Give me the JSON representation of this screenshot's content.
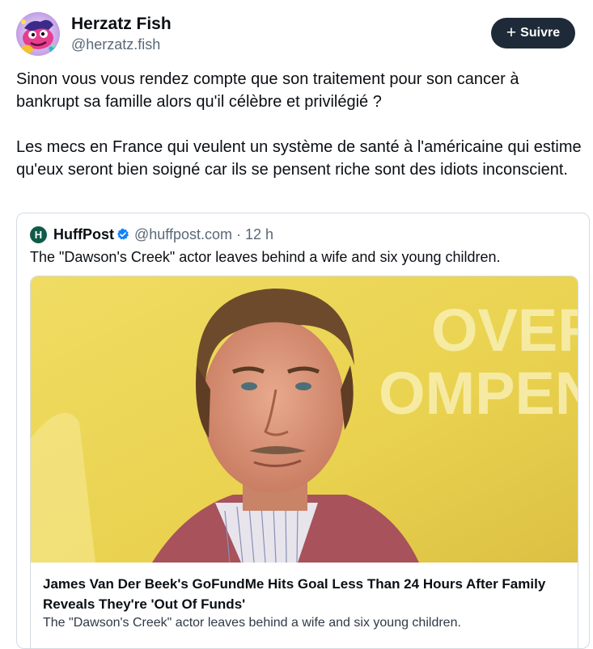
{
  "author": {
    "display_name": "Herzatz Fish",
    "handle": "@herzatz.fish",
    "avatar_icon": "colorful-cartoon-avatar"
  },
  "follow_button": {
    "icon": "plus-icon",
    "label": "Suivre",
    "bg_color": "#1e2a38"
  },
  "post": {
    "paragraph_1": "Sinon vous vous rendez compte que son traitement pour son cancer à bankrupt sa famille alors qu'il célèbre et privilégié ?",
    "paragraph_2": "Les mecs en France qui veulent un système de santé à l'américaine qui estime qu'eux seront bien soigné car ils se pensent riche sont des idiots inconscient."
  },
  "quoted_post": {
    "logo_icon": "huffpost-logo",
    "logo_letter": "H",
    "name": "HuffPost",
    "verified_icon": "verified-badge-icon",
    "handle": "@huffpost.com",
    "separator": "·",
    "time": "12 h",
    "text": "The \"Dawson's Creek\" actor leaves behind a wife and six young children.",
    "link_card": {
      "image": "photo-of-man-against-yellow-backdrop",
      "backdrop_text_1": "OVER",
      "backdrop_text_2": "OMPEN",
      "title": "James Van Der Beek's GoFundMe Hits Goal Less Than 24 Hours After Family Reveals They're 'Out Of Funds'",
      "description": "The \"Dawson's Creek\" actor leaves behind a wife and six young children."
    }
  }
}
